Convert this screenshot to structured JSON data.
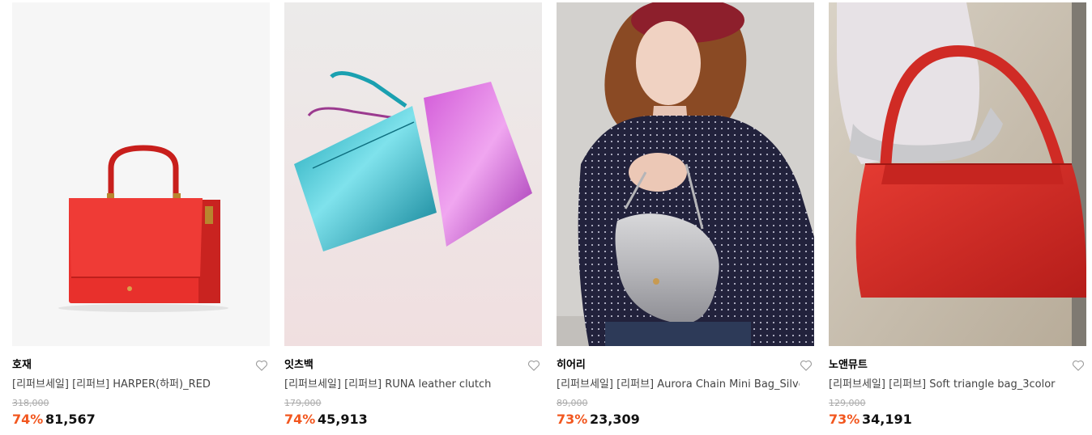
{
  "products": [
    {
      "brand": "호재",
      "title": "[리퍼브세일] [리퍼브] HARPER(하퍼)_RED",
      "original_price": "318,000",
      "discount_rate": "74%",
      "sale_price": "81,567",
      "image_icon": "red-structured-handbag-image",
      "wishlist_icon": "heart-outline-icon"
    },
    {
      "brand": "잇츠백",
      "title": "[리퍼브세일] [리퍼브] RUNA leather clutch",
      "original_price": "179,000",
      "discount_rate": "74%",
      "sale_price": "45,913",
      "image_icon": "metallic-clutch-bags-image",
      "wishlist_icon": "heart-outline-icon"
    },
    {
      "brand": "히어리",
      "title": "[리퍼브세일] [리퍼브] Aurora Chain Mini Bag_Silver",
      "original_price": "89,000",
      "discount_rate": "73%",
      "sale_price": "23,309",
      "image_icon": "model-with-silver-bag-image",
      "wishlist_icon": "heart-outline-icon"
    },
    {
      "brand": "노앤뮤트",
      "title": "[리퍼브세일] [리퍼브] Soft triangle bag_3color",
      "original_price": "129,000",
      "discount_rate": "73%",
      "sale_price": "34,191",
      "image_icon": "red-shoulder-bag-image",
      "wishlist_icon": "heart-outline-icon"
    }
  ],
  "colors": {
    "discount": "#f2571f",
    "original_price": "#aaaaaa",
    "title": "#444444"
  }
}
